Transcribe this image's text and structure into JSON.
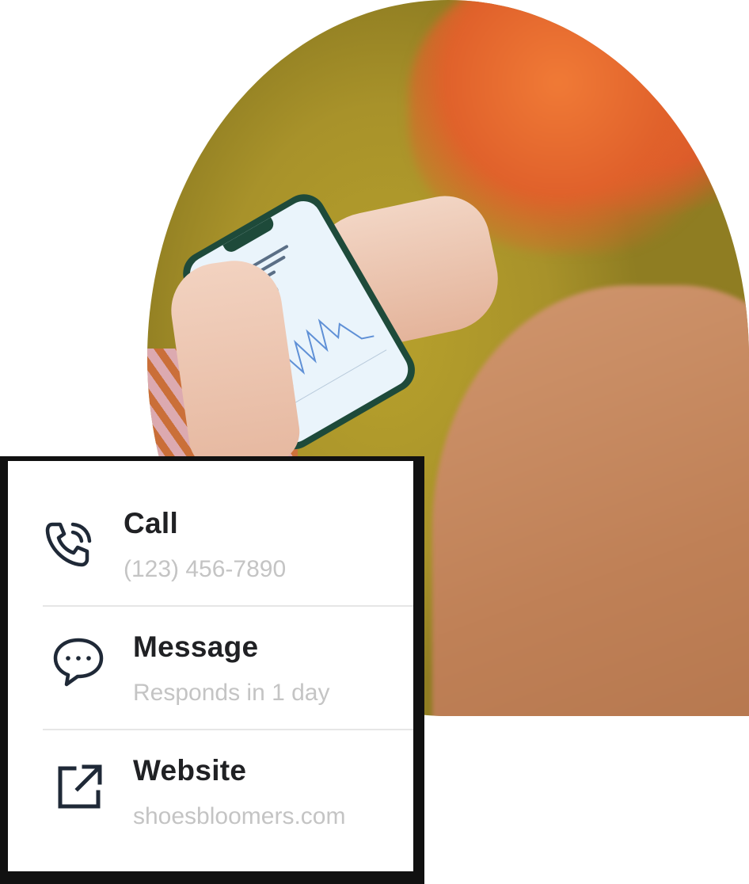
{
  "contact_options": [
    {
      "title": "Call",
      "subtitle": "(123) 456-7890",
      "icon": "phone-icon"
    },
    {
      "title": "Message",
      "subtitle": "Responds in 1 day",
      "icon": "chat-bubble-icon"
    },
    {
      "title": "Website",
      "subtitle": "shoesbloomers.com",
      "icon": "external-link-icon"
    }
  ],
  "colors": {
    "title": "#202124",
    "subtitle": "#c4c4c4",
    "divider": "#e6e6e6",
    "card_border": "#111111"
  }
}
